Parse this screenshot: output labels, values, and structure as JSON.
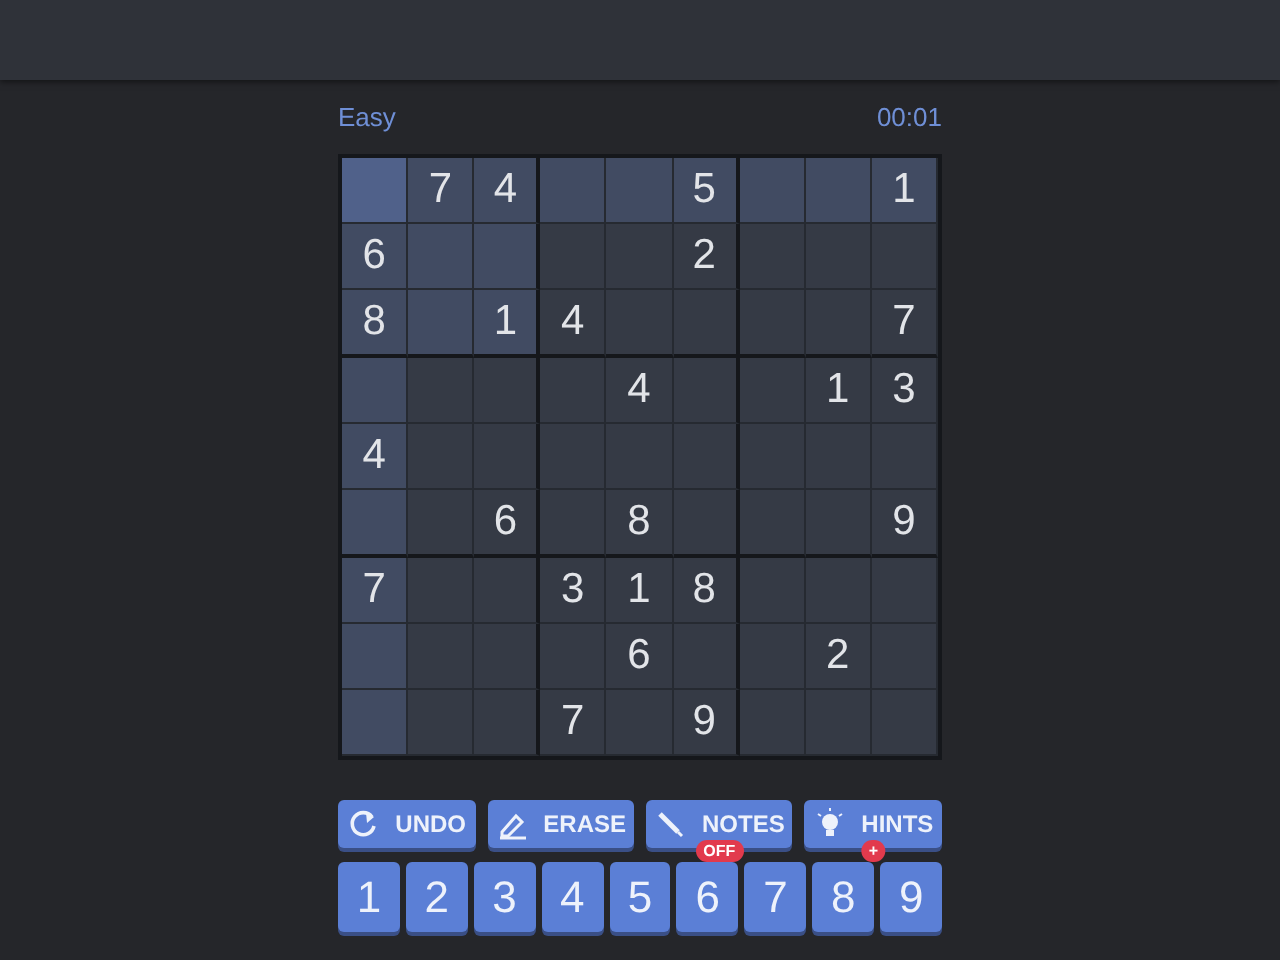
{
  "header": {
    "difficulty": "Easy",
    "timer": "00:01"
  },
  "board": {
    "rows": [
      [
        {
          "selected": true,
          "highlighted": true
        },
        {
          "value": "7",
          "selected": false,
          "highlighted": true
        },
        {
          "value": "4",
          "selected": false,
          "highlighted": true
        },
        {
          "selected": false,
          "highlighted": true
        },
        {
          "selected": false,
          "highlighted": true
        },
        {
          "value": "5",
          "selected": false,
          "highlighted": true
        },
        {
          "selected": false,
          "highlighted": true
        },
        {
          "selected": false,
          "highlighted": true
        },
        {
          "value": "1",
          "selected": false,
          "highlighted": true
        }
      ],
      [
        {
          "value": "6",
          "selected": false,
          "highlighted": true
        },
        {
          "selected": false,
          "highlighted": true
        },
        {
          "selected": false,
          "highlighted": true
        },
        {
          "selected": false,
          "highlighted": false
        },
        {
          "selected": false,
          "highlighted": false
        },
        {
          "value": "2",
          "selected": false,
          "highlighted": false
        },
        {
          "selected": false,
          "highlighted": false
        },
        {
          "selected": false,
          "highlighted": false
        },
        {
          "selected": false,
          "highlighted": false
        }
      ],
      [
        {
          "value": "8",
          "selected": false,
          "highlighted": true
        },
        {
          "selected": false,
          "highlighted": true
        },
        {
          "value": "1",
          "selected": false,
          "highlighted": true
        },
        {
          "value": "4",
          "selected": false,
          "highlighted": false
        },
        {
          "selected": false,
          "highlighted": false
        },
        {
          "selected": false,
          "highlighted": false
        },
        {
          "selected": false,
          "highlighted": false
        },
        {
          "selected": false,
          "highlighted": false
        },
        {
          "value": "7",
          "selected": false,
          "highlighted": false
        }
      ],
      [
        {
          "selected": false,
          "highlighted": true
        },
        {
          "selected": false,
          "highlighted": false
        },
        {
          "selected": false,
          "highlighted": false
        },
        {
          "selected": false,
          "highlighted": false
        },
        {
          "value": "4",
          "selected": false,
          "highlighted": false
        },
        {
          "selected": false,
          "highlighted": false
        },
        {
          "selected": false,
          "highlighted": false
        },
        {
          "value": "1",
          "selected": false,
          "highlighted": false
        },
        {
          "value": "3",
          "selected": false,
          "highlighted": false
        }
      ],
      [
        {
          "value": "4",
          "selected": false,
          "highlighted": true
        },
        {
          "selected": false,
          "highlighted": false
        },
        {
          "selected": false,
          "highlighted": false
        },
        {
          "selected": false,
          "highlighted": false
        },
        {
          "selected": false,
          "highlighted": false
        },
        {
          "selected": false,
          "highlighted": false
        },
        {
          "selected": false,
          "highlighted": false
        },
        {
          "selected": false,
          "highlighted": false
        },
        {
          "selected": false,
          "highlighted": false
        }
      ],
      [
        {
          "selected": false,
          "highlighted": true
        },
        {
          "selected": false,
          "highlighted": false
        },
        {
          "value": "6",
          "selected": false,
          "highlighted": false
        },
        {
          "selected": false,
          "highlighted": false
        },
        {
          "value": "8",
          "selected": false,
          "highlighted": false
        },
        {
          "selected": false,
          "highlighted": false
        },
        {
          "selected": false,
          "highlighted": false
        },
        {
          "selected": false,
          "highlighted": false
        },
        {
          "value": "9",
          "selected": false,
          "highlighted": false
        }
      ],
      [
        {
          "value": "7",
          "selected": false,
          "highlighted": true
        },
        {
          "selected": false,
          "highlighted": false
        },
        {
          "selected": false,
          "highlighted": false
        },
        {
          "value": "3",
          "selected": false,
          "highlighted": false
        },
        {
          "value": "1",
          "selected": false,
          "highlighted": false
        },
        {
          "value": "8",
          "selected": false,
          "highlighted": false
        },
        {
          "selected": false,
          "highlighted": false
        },
        {
          "selected": false,
          "highlighted": false
        },
        {
          "selected": false,
          "highlighted": false
        }
      ],
      [
        {
          "selected": false,
          "highlighted": true
        },
        {
          "selected": false,
          "highlighted": false
        },
        {
          "selected": false,
          "highlighted": false
        },
        {
          "selected": false,
          "highlighted": false
        },
        {
          "value": "6",
          "selected": false,
          "highlighted": false
        },
        {
          "selected": false,
          "highlighted": false
        },
        {
          "selected": false,
          "highlighted": false
        },
        {
          "value": "2",
          "selected": false,
          "highlighted": false
        },
        {
          "selected": false,
          "highlighted": false
        }
      ],
      [
        {
          "selected": false,
          "highlighted": true
        },
        {
          "selected": false,
          "highlighted": false
        },
        {
          "selected": false,
          "highlighted": false
        },
        {
          "value": "7",
          "selected": false,
          "highlighted": false
        },
        {
          "selected": false,
          "highlighted": false
        },
        {
          "value": "9",
          "selected": false,
          "highlighted": false
        },
        {
          "selected": false,
          "highlighted": false
        },
        {
          "selected": false,
          "highlighted": false
        },
        {
          "selected": false,
          "highlighted": false
        }
      ]
    ]
  },
  "actions": [
    {
      "kind": "undo",
      "label": "UNDO"
    },
    {
      "kind": "erase",
      "label": "ERASE"
    },
    {
      "kind": "notes",
      "label": "NOTES",
      "badge": "OFF"
    },
    {
      "kind": "hints",
      "label": "HINTS",
      "badge": "+"
    }
  ],
  "numbers": [
    "1",
    "2",
    "3",
    "4",
    "5",
    "6",
    "7",
    "8",
    "9"
  ]
}
